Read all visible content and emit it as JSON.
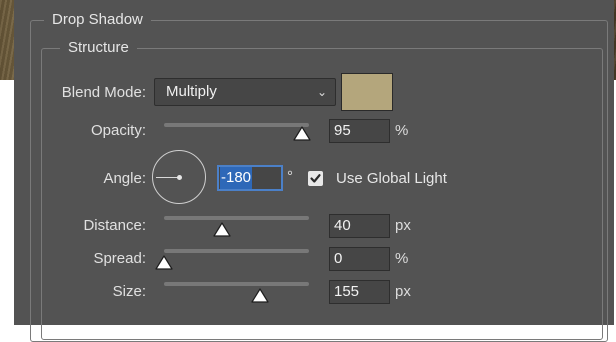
{
  "panel": {
    "section_title": "Drop Shadow",
    "group_title": "Structure"
  },
  "blend_mode": {
    "label": "Blend Mode:",
    "value": "Multiply",
    "chevron_icon": "chevron-down-icon",
    "swatch_color": "#b4a67c"
  },
  "opacity": {
    "label": "Opacity:",
    "value": "95",
    "unit": "%",
    "slider_fraction": 0.95
  },
  "angle": {
    "label": "Angle:",
    "value": "-180",
    "unit": "°",
    "use_global_light_label": "Use Global Light",
    "use_global_light_checked": true
  },
  "distance": {
    "label": "Distance:",
    "value": "40",
    "unit": "px",
    "slider_fraction": 0.4
  },
  "spread": {
    "label": "Spread:",
    "value": "0",
    "unit": "%",
    "slider_fraction": 0.0
  },
  "size": {
    "label": "Size:",
    "value": "155",
    "unit": "px",
    "slider_fraction": 0.66
  }
}
